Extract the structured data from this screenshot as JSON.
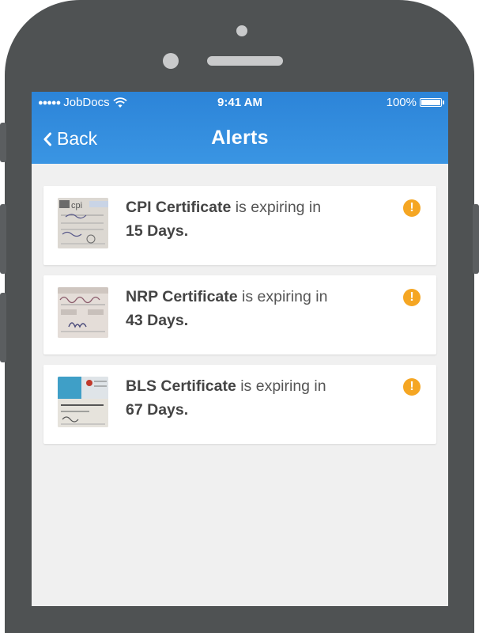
{
  "status_bar": {
    "carrier": "JobDocs",
    "time": "9:41 AM",
    "battery": "100%"
  },
  "nav": {
    "back_label": "Back",
    "title": "Alerts"
  },
  "alerts": [
    {
      "name": "CPI Certificate",
      "middle": "is expiring in",
      "days": "15 Days.",
      "thumb_text": "cpi"
    },
    {
      "name": "NRP Certificate",
      "middle": "is expiring in",
      "days": "43 Days."
    },
    {
      "name": "BLS Certificate",
      "middle": "is expiring in",
      "days": "67 Days."
    }
  ],
  "colors": {
    "nav_blue": "#2f89dc",
    "alert_orange": "#f5a623",
    "phone_body": "#4f5253"
  },
  "icons": {
    "alert": "exclamation-circle-icon",
    "back": "chevron-left-icon",
    "wifi": "wifi-icon",
    "battery": "battery-icon"
  }
}
